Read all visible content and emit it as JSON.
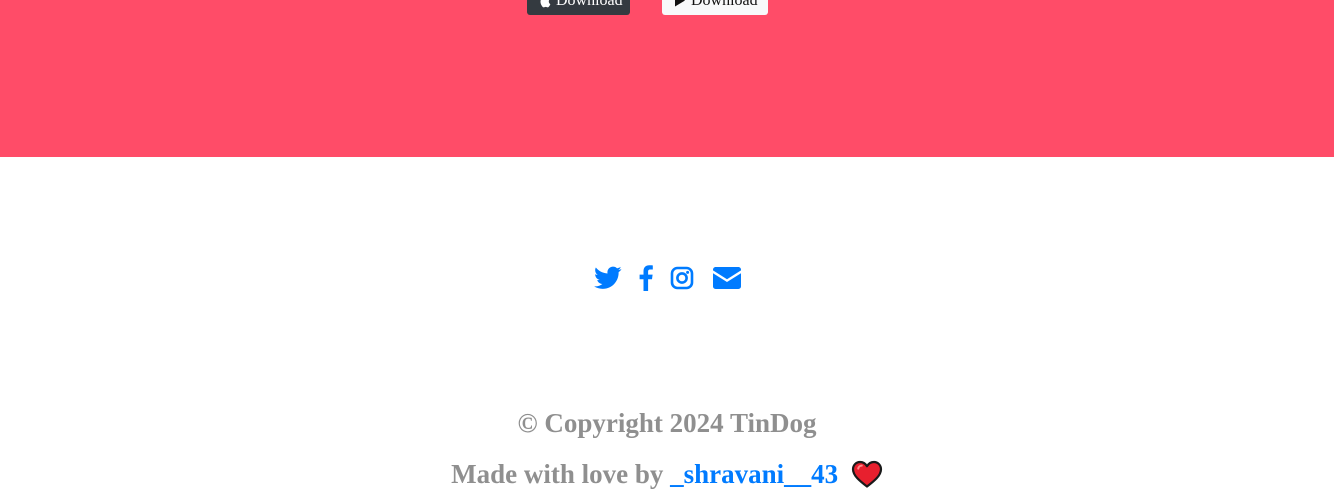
{
  "cta": {
    "background": "#ff4c68",
    "buttons": [
      {
        "label": "Download",
        "icon": "apple-icon",
        "style": "dark"
      },
      {
        "label": "Download",
        "icon": "play-store-icon",
        "style": "light"
      }
    ]
  },
  "footer": {
    "social": [
      {
        "icon": "twitter-icon",
        "color": "#007bff"
      },
      {
        "icon": "facebook-icon",
        "color": "#007bff"
      },
      {
        "icon": "instagram-icon",
        "color": "#007bff"
      },
      {
        "icon": "envelope-icon",
        "color": "#007bff"
      }
    ],
    "copyright": "© Copyright 2024 TinDog",
    "made_with_love_prefix": "Made with love by ",
    "author_link": "_shravani__43",
    "heart_icon": "heart-icon"
  }
}
